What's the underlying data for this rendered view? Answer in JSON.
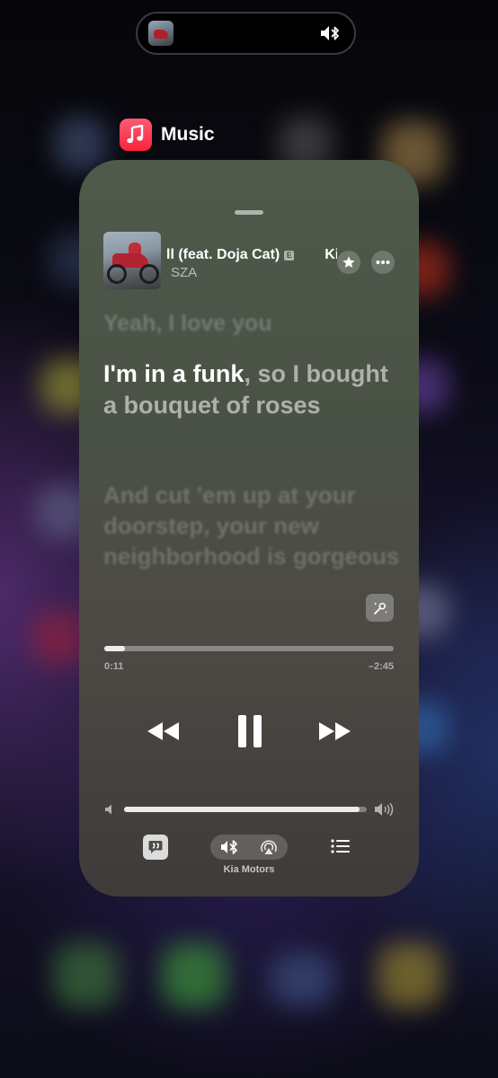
{
  "island": {
    "art_icon": "album-thumbnail",
    "status_icon": "speaker-bluetooth-icon"
  },
  "app": {
    "name": "Music",
    "icon": "music-note-icon",
    "accent": "#fa233b"
  },
  "now_playing": {
    "title": "ll (feat. Doja Cat)",
    "title_marquee_next": "Ki",
    "explicit_badge": "E",
    "artist": "SZA",
    "elapsed": "0:11",
    "remaining": "–2:45",
    "progress": 0.07
  },
  "lyrics": {
    "previous": "Yeah, I love you",
    "current_sung": "I'm in a funk",
    "current_rest": ", so I bought a bouquet of roses",
    "next": "And cut 'em up at your doorstep, your new neighborhood is gorgeous"
  },
  "volume": {
    "level": 0.97
  },
  "footer": {
    "device_name": "Kia Motors"
  },
  "icons": [
    "star-icon",
    "more-icon",
    "sing-icon",
    "rewind-icon",
    "pause-icon",
    "forward-icon",
    "volume-low-icon",
    "volume-high-icon",
    "lyrics-icon",
    "bluetooth-speaker-icon",
    "airplay-icon",
    "queue-icon"
  ]
}
